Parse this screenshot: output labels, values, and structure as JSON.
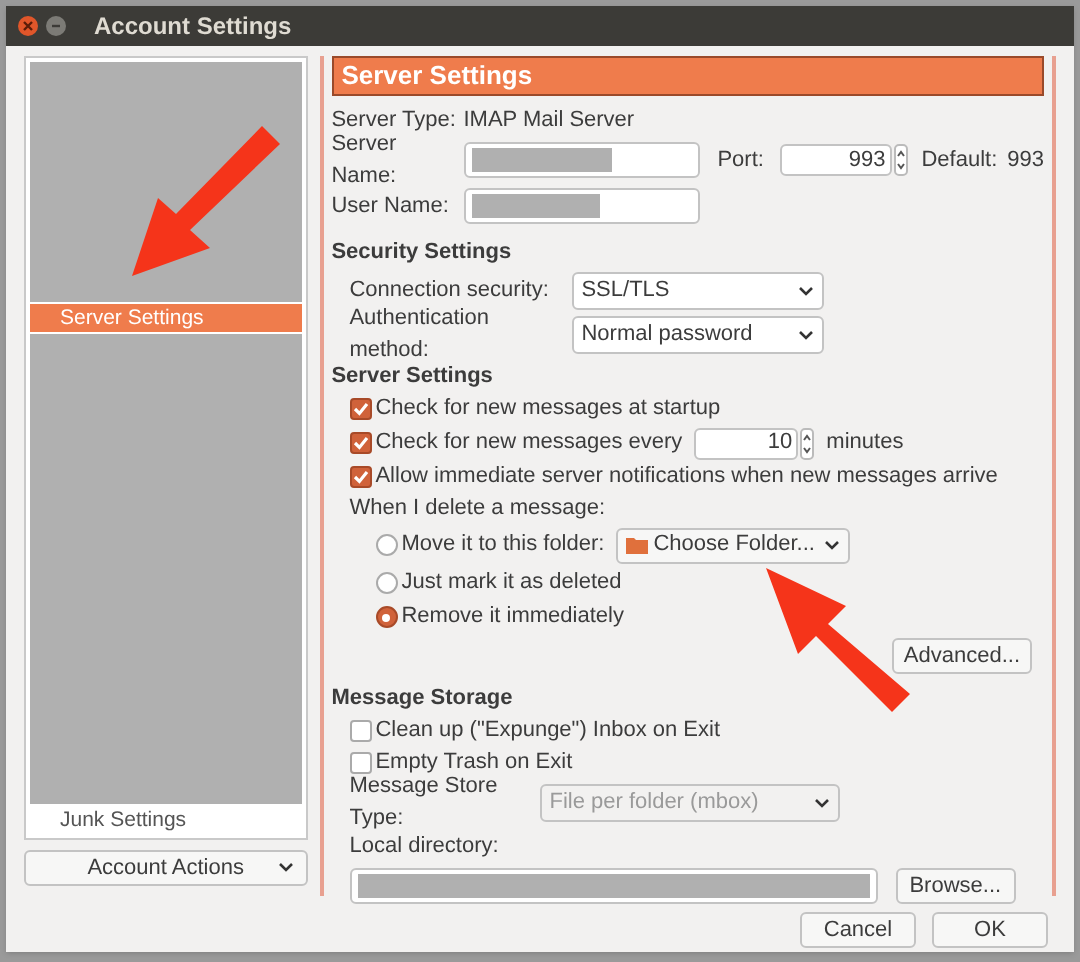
{
  "window": {
    "title": "Account Settings"
  },
  "sidebar": {
    "items": [
      {
        "label": "Server Settings",
        "selected": true
      },
      {
        "label": "Junk Settings",
        "selected": false
      }
    ],
    "account_actions": "Account Actions"
  },
  "panel": {
    "header": "Server Settings",
    "server_type": {
      "label": "Server Type:",
      "value": "IMAP Mail Server"
    },
    "server_name": {
      "label": "Server Name:"
    },
    "port": {
      "label": "Port:",
      "value": "993"
    },
    "default_port": {
      "label": "Default:",
      "value": "993"
    },
    "user_name": {
      "label": "User Name:"
    },
    "security": {
      "heading": "Security Settings",
      "fields": [
        {
          "label": "Connection security:",
          "value": "SSL/TLS"
        },
        {
          "label": "Authentication method:",
          "value": "Normal password"
        }
      ]
    },
    "server": {
      "heading": "Server Settings",
      "checks": [
        {
          "kind": "plain",
          "label": "Check for new messages at startup",
          "checked": true
        },
        {
          "kind": "interval",
          "label": "Check for new messages every",
          "checked": true,
          "value": "10",
          "unit": "minutes"
        },
        {
          "kind": "plain",
          "label": "Allow immediate server notifications when new messages arrive",
          "checked": true
        }
      ],
      "delete_prompt": "When I delete a message:",
      "radios": [
        {
          "kind": "folder",
          "label": "Move it to this folder:",
          "selected": false,
          "folder": "Choose Folder..."
        },
        {
          "kind": "plain",
          "label": "Just mark it as deleted",
          "selected": false
        },
        {
          "kind": "plain",
          "label": "Remove it immediately",
          "selected": true
        }
      ],
      "advanced": "Advanced..."
    },
    "storage": {
      "heading": "Message Storage",
      "checks": [
        {
          "label": "Clean up (\"Expunge\") Inbox on Exit",
          "checked": false
        },
        {
          "label": "Empty Trash on Exit",
          "checked": false
        }
      ],
      "store_type": {
        "label": "Message Store Type:",
        "value": "File per folder (mbox)",
        "disabled": true
      },
      "local_directory": {
        "label": "Local directory:"
      },
      "browse": "Browse..."
    }
  },
  "buttons": [
    {
      "label": "Cancel"
    },
    {
      "label": "OK"
    }
  ]
}
